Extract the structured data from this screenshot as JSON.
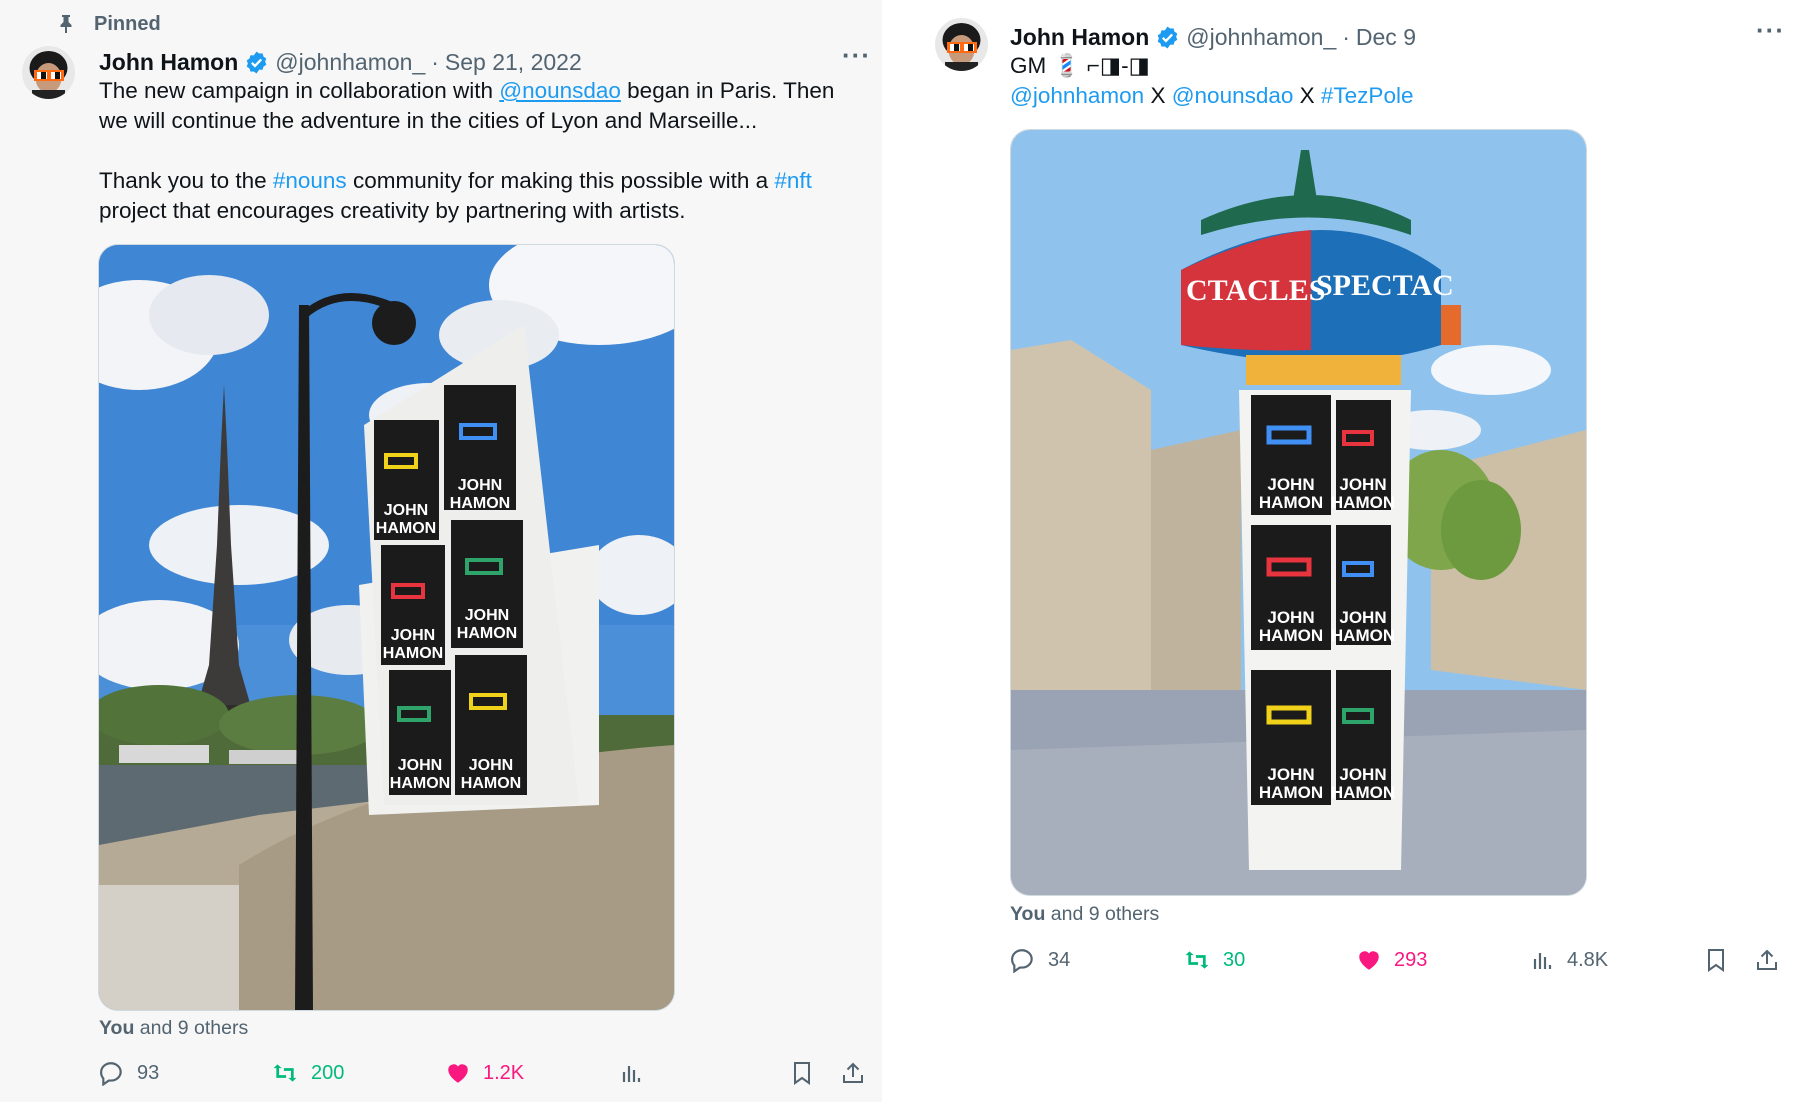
{
  "left_tweet": {
    "pinned_label": "Pinned",
    "author": {
      "name": "John Hamon",
      "handle": "@johnhamon_"
    },
    "separator": "·",
    "date": "Sep 21, 2022",
    "more_label": "···",
    "text": {
      "p1_a": "The new campaign in collaboration with ",
      "p1_mention": "@nounsdao",
      "p1_b": " began in Paris. Then we will continue the adventure in the cities of Lyon and Marseille...",
      "p2_a": "Thank you to the ",
      "p2_tag1": "#nouns",
      "p2_b": " community for making this possible with a ",
      "p2_tag2": "#nft",
      "p2_c": " project that encourages creativity by partnering with artists."
    },
    "photo": {
      "poster_lines": [
        "JOHN",
        "HAMON"
      ],
      "glasses_colors": [
        "#f0d21a",
        "#3f8ff5",
        "#e8343f",
        "#2ea36a",
        "#2ea36a",
        "#f0d21a"
      ]
    },
    "likers": {
      "you": "You",
      "rest": " and 9 others"
    },
    "actions": {
      "replies": "93",
      "reposts": "200",
      "likes": "1.2K",
      "views": ""
    }
  },
  "right_tweet": {
    "author": {
      "name": "John Hamon",
      "handle": "@johnhamon_"
    },
    "separator": "·",
    "date": "Dec 9",
    "more_label": "···",
    "text": {
      "line1": "GM 💈 ⌐◨-◨",
      "mention1": "@johnhamon",
      "x1": " X ",
      "mention2": "@nounsdao",
      "x2": " X ",
      "tag": "#TezPole"
    },
    "photo": {
      "column_band_text": [
        "CTACLES",
        "SPECTAC"
      ],
      "poster_lines": [
        "JOHN",
        "HAMON"
      ],
      "glasses_colors": [
        "#3f8ff5",
        "#e8343f",
        "#e8343f",
        "#3f8ff5",
        "#f0d21a",
        "#2ea36a"
      ]
    },
    "likers": {
      "you": "You",
      "rest": " and 9 others"
    },
    "actions": {
      "replies": "34",
      "reposts": "30",
      "likes": "293",
      "views": "4.8K"
    }
  },
  "colors": {
    "link": "#1d9bf0",
    "repost": "#00ba7c",
    "like": "#f91880",
    "muted": "#536471",
    "verified": "#1d9bf0"
  }
}
